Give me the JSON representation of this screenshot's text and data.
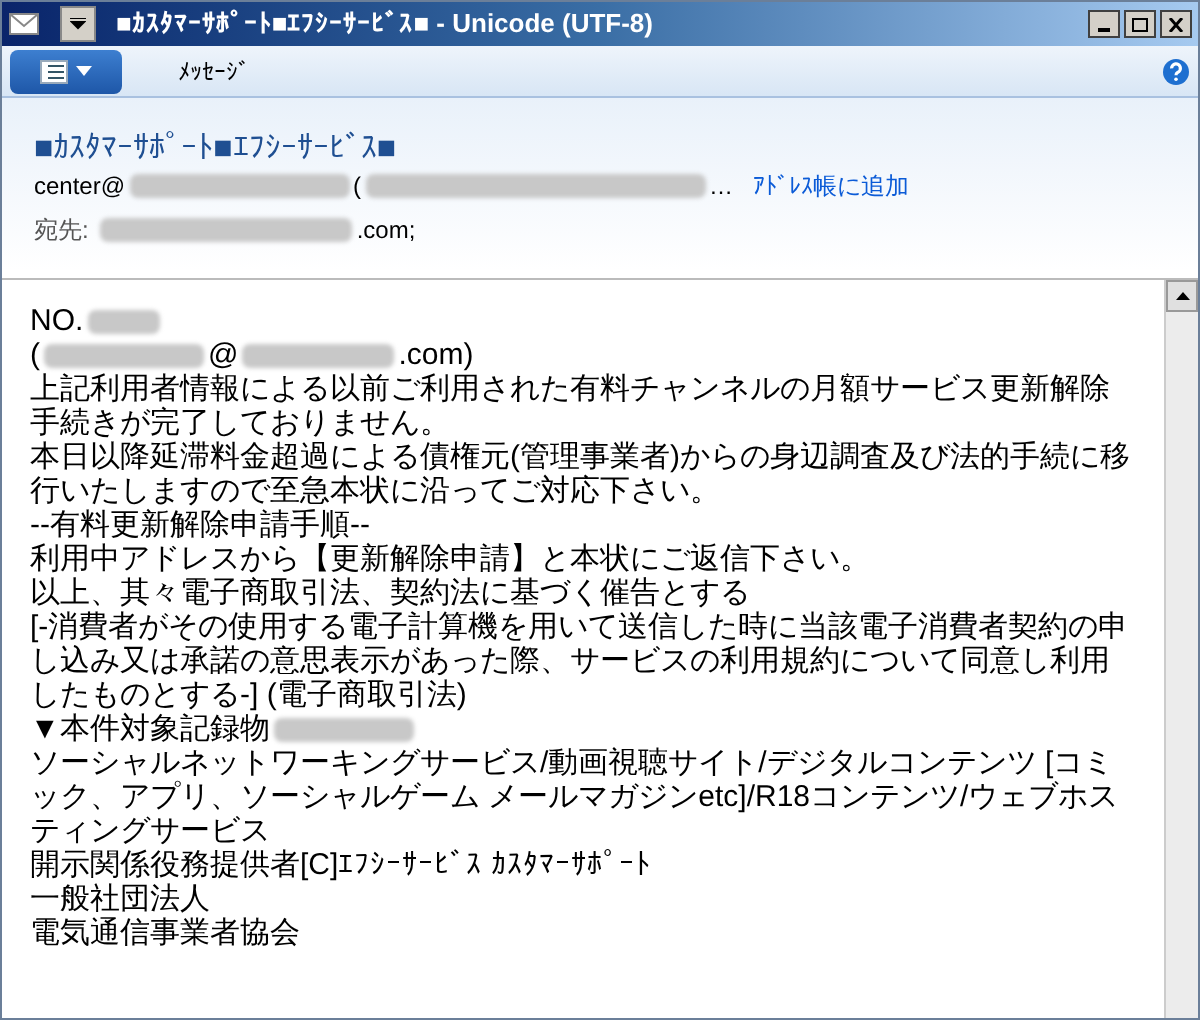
{
  "window": {
    "title": "■ｶｽﾀﾏｰｻﾎﾟｰﾄ■ｴﾌｼｰｻｰﾋﾞｽ■ - Unicode (UTF-8)"
  },
  "toolbar": {
    "tabs": [
      {
        "label": "ﾒｯｾｰｼﾞ",
        "selected": false
      }
    ]
  },
  "header": {
    "subject": "■ｶｽﾀﾏｰｻﾎﾟｰﾄ■ｴﾌｼｰｻｰﾋﾞｽ■",
    "from": [
      {
        "kind": "text",
        "text": "center@"
      },
      {
        "kind": "redacted"
      },
      {
        "kind": "text",
        "text": "("
      },
      {
        "kind": "redacted"
      },
      {
        "kind": "text",
        "text": "…"
      }
    ],
    "add_contact": "ｱﾄﾞﾚｽ帳に追加",
    "to_label": "宛先:",
    "to": [
      {
        "kind": "redacted"
      },
      {
        "kind": "text",
        "text": ".com;"
      }
    ]
  },
  "body": [
    [
      {
        "kind": "text",
        "text": "NO."
      },
      {
        "kind": "redacted"
      }
    ],
    [
      {
        "kind": "text",
        "text": "("
      },
      {
        "kind": "redacted"
      },
      {
        "kind": "text",
        "text": "@"
      },
      {
        "kind": "redacted"
      },
      {
        "kind": "text",
        "text": ".com)"
      }
    ],
    [
      {
        "kind": "text",
        "text": "上記利用者情報による以前ご利用された有料チャンネルの月額サービス更新解除手続きが完了しておりません。"
      }
    ],
    [
      {
        "kind": "text",
        "text": "本日以降延滞料金超過による債権元(管理事業者)からの身辺調査及び法的手続に移行いたしますので至急本状に沿ってご対応下さい。"
      }
    ],
    [
      {
        "kind": "text",
        "text": "--有料更新解除申請手順--"
      }
    ],
    [
      {
        "kind": "text",
        "text": "利用中アドレスから【更新解除申請】と本状にご返信下さい。"
      }
    ],
    [
      {
        "kind": "text",
        "text": "以上、其々電子商取引法、契約法に基づく催告とする"
      }
    ],
    [
      {
        "kind": "text",
        "text": "[-消費者がその使用する電子計算機を用いて送信した時に当該電子消費者契約の申し込み又は承諾の意思表示があった際、サービスの利用規約について同意し利用したものとする-] (電子商取引法)"
      }
    ],
    [
      {
        "kind": "text",
        "text": "▼本件対象記録物"
      },
      {
        "kind": "redacted"
      }
    ],
    [
      {
        "kind": "text",
        "text": "ソーシャルネットワーキングサービス/動画視聴サイト/デジタルコンテンツ [コミック、アプリ、ソーシャルゲーム メールマガジンetc]/R18コンテンツ/ウェブホスティングサービス"
      }
    ],
    [
      {
        "kind": "text",
        "text": "開示関係役務提供者[C]ｴﾌｼｰｻｰﾋﾞｽ ｶｽﾀﾏｰｻﾎﾟｰﾄ"
      }
    ],
    [
      {
        "kind": "text",
        "text": "一般社団法人"
      }
    ],
    [
      {
        "kind": "text",
        "text": "電気通信事業者協会"
      }
    ]
  ]
}
